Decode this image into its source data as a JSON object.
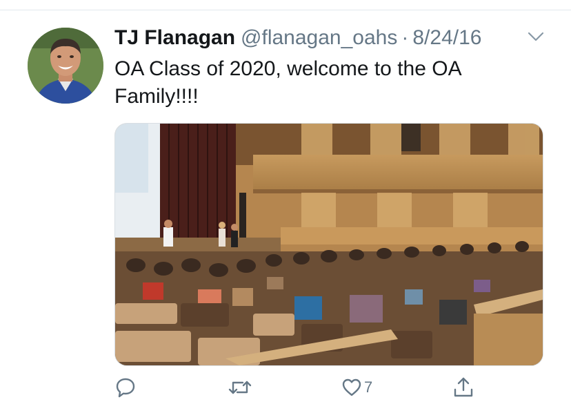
{
  "tweet": {
    "author_name": "TJ Flanagan",
    "handle": "@flanagan_oahs",
    "separator": "·",
    "date": "8/24/16",
    "text": "OA Class of 2020, welcome to the OA Family!!!!"
  },
  "actions": {
    "reply_icon": "reply-icon",
    "retweet_icon": "retweet-icon",
    "like_icon": "heart-icon",
    "like_count": "7",
    "share_icon": "share-icon"
  },
  "colors": {
    "text": "#14171a",
    "secondary": "#657786",
    "divider": "#e1e8ed"
  }
}
